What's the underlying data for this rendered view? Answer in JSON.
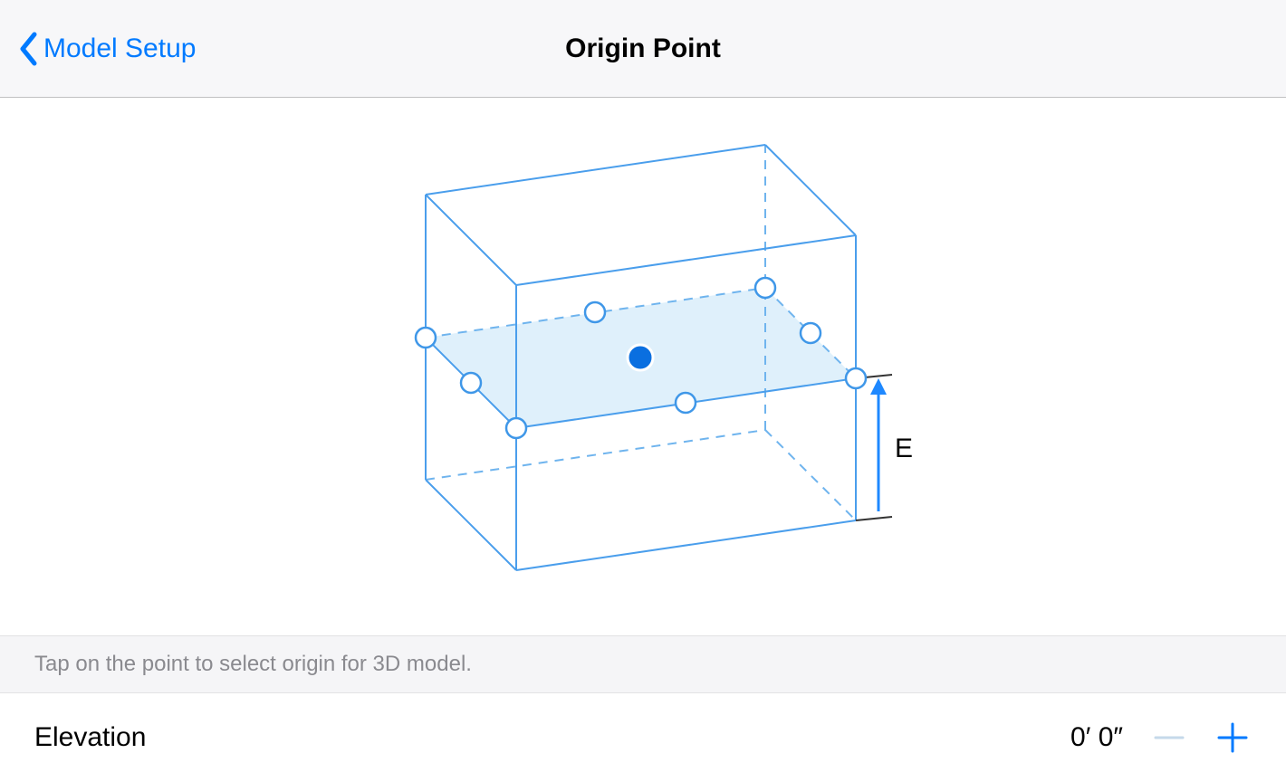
{
  "nav": {
    "back_label": "Model Setup",
    "title": "Origin Point"
  },
  "diagram": {
    "elevation_marker": "E",
    "selectable_points": 9,
    "selected_point": "center"
  },
  "hint": {
    "text": "Tap on the point to select origin for 3D model."
  },
  "elevation": {
    "label": "Elevation",
    "value": "0′ 0″"
  }
}
